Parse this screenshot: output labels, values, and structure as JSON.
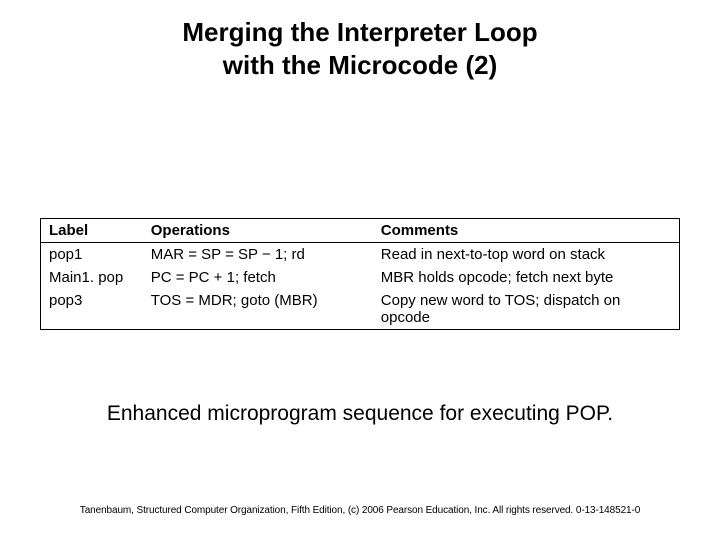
{
  "title_line1": "Merging the Interpreter Loop",
  "title_line2": "with the Microcode (2)",
  "table": {
    "headers": {
      "label": "Label",
      "ops": "Operations",
      "comments": "Comments"
    },
    "rows": [
      {
        "label": "pop1",
        "ops": "MAR = SP = SP − 1; rd",
        "comments": "Read in next-to-top word on stack"
      },
      {
        "label": "Main1. pop",
        "ops": "PC = PC + 1; fetch",
        "comments": "MBR holds opcode; fetch next byte"
      },
      {
        "label": "pop3",
        "ops": "TOS = MDR; goto (MBR)",
        "comments": "Copy new word to TOS; dispatch on opcode"
      }
    ]
  },
  "caption": "Enhanced microprogram sequence for executing POP.",
  "footer": "Tanenbaum, Structured Computer Organization, Fifth Edition, (c) 2006 Pearson Education, Inc. All rights reserved. 0-13-148521-0"
}
